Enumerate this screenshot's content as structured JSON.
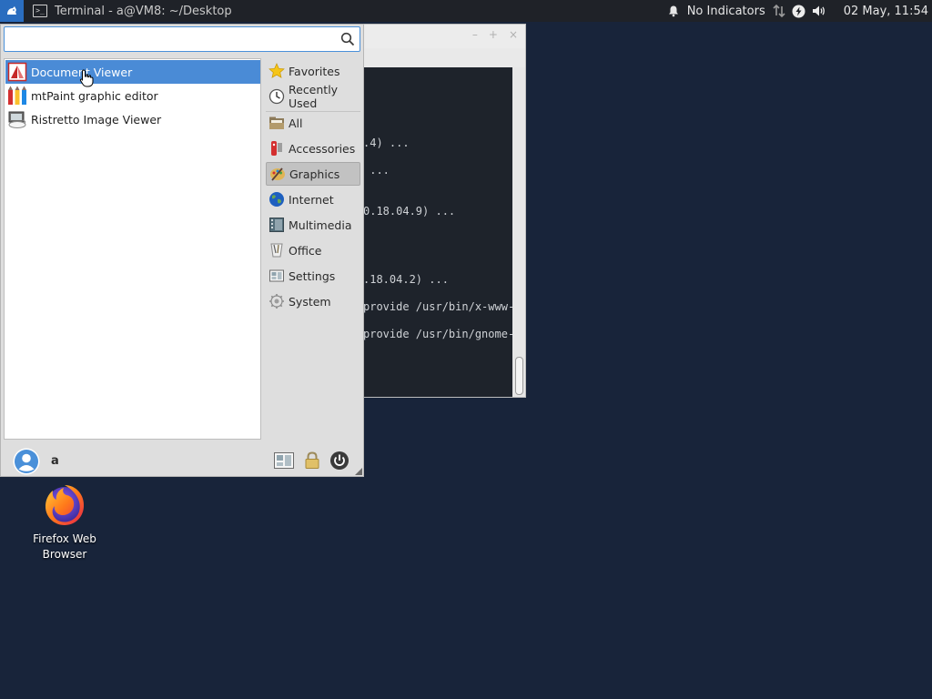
{
  "top_panel": {
    "menu_button_icon": "whisker-menu-icon",
    "taskbar_item": {
      "icon": "terminal-icon",
      "icon_glyph": ">_",
      "title": "Terminal - a@VM8: ~/Desktop"
    },
    "tray": {
      "notification_icon": "bell-icon",
      "indicator_text": "No Indicators",
      "network_icon": "network-arrows-icon",
      "power_icon": "power-bolt-icon",
      "volume_icon": "volume-icon",
      "clock": "02 May, 11:54"
    }
  },
  "terminal": {
    "title": "",
    "controls": [
      "–",
      "+",
      "×"
    ],
    "lines": [
      ".4) ...",
      " ...",
      "0.18.04.9) ...",
      ".18.04.2) ...",
      "provide /usr/bin/x-www-b",
      "provide /usr/bin/gnome-w"
    ]
  },
  "whisker_menu": {
    "search": {
      "value": "",
      "placeholder": "",
      "icon": "search-icon"
    },
    "apps": [
      {
        "label": "Document Viewer",
        "icon": "document-viewer-icon",
        "selected": true
      },
      {
        "label": "mtPaint graphic editor",
        "icon": "mtpaint-icon",
        "selected": false
      },
      {
        "label": "Ristretto Image Viewer",
        "icon": "ristretto-icon",
        "selected": false
      }
    ],
    "categories": [
      {
        "label": "Favorites",
        "icon": "star-icon"
      },
      {
        "label": "Recently Used",
        "icon": "clock-icon"
      },
      {
        "label": "All",
        "icon": "folder-icon"
      },
      {
        "label": "Accessories",
        "icon": "accessories-icon"
      },
      {
        "label": "Graphics",
        "icon": "graphics-icon",
        "active": true
      },
      {
        "label": "Internet",
        "icon": "globe-icon"
      },
      {
        "label": "Multimedia",
        "icon": "multimedia-icon"
      },
      {
        "label": "Office",
        "icon": "office-icon"
      },
      {
        "label": "Settings",
        "icon": "settings-icon"
      },
      {
        "label": "System",
        "icon": "system-gear-icon"
      }
    ],
    "footer": {
      "user_name": "a",
      "avatar_icon": "user-avatar-icon",
      "settings_button_icon": "settings-manager-icon",
      "lock_button_icon": "lock-icon",
      "logout_button_icon": "power-icon"
    }
  },
  "desktop": {
    "icons": [
      {
        "label": "Firefox Web Browser",
        "icon": "firefox-icon"
      }
    ]
  },
  "colors": {
    "desktop_bg": "#18243a",
    "panel_bg": "#1f2228",
    "selection": "#4a8bd6",
    "menu_bg": "#dedede"
  }
}
